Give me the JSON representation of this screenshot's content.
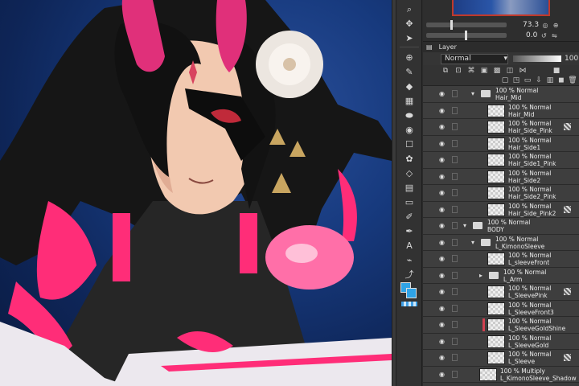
{
  "navigator": {
    "zoom_value": "73.3",
    "rotate_value": "0.0"
  },
  "layer_panel": {
    "tab_label": "Layer",
    "blend_mode": "Normal",
    "opacity": "100"
  },
  "layers": [
    {
      "line1": "100 % Normal",
      "line2": "Hair_Mid",
      "type": "folder",
      "indent": 1,
      "expanded": true
    },
    {
      "line1": "100 % Normal",
      "line2": "Hair_Mid",
      "type": "layer",
      "indent": 2
    },
    {
      "line1": "100 % Normal",
      "line2": "Hair_Side_Pink",
      "type": "layer",
      "indent": 2,
      "mask": true
    },
    {
      "line1": "100 % Normal",
      "line2": "Hair_Side1",
      "type": "layer",
      "indent": 2
    },
    {
      "line1": "100 % Normal",
      "line2": "Hair_Side1_Pink",
      "type": "layer",
      "indent": 2
    },
    {
      "line1": "100 % Normal",
      "line2": "Hair_Side2",
      "type": "layer",
      "indent": 2
    },
    {
      "line1": "100 % Normal",
      "line2": "Hair_Side2_Pink",
      "type": "layer",
      "indent": 2
    },
    {
      "line1": "100 % Normal",
      "line2": "Hair_Side_Pink2",
      "type": "layer",
      "indent": 2,
      "mask": true
    },
    {
      "line1": "100 % Normal",
      "line2": "BODY",
      "type": "folder",
      "indent": 0,
      "expanded": true
    },
    {
      "line1": "100 % Normal",
      "line2": "L_KimonoSleeve",
      "type": "folder",
      "indent": 1,
      "expanded": true
    },
    {
      "line1": "100 % Normal",
      "line2": "L_sleeveFront",
      "type": "layer",
      "indent": 2
    },
    {
      "line1": "100 % Normal",
      "line2": "L_Arm",
      "type": "folder",
      "indent": 2,
      "expanded": false
    },
    {
      "line1": "100 % Normal",
      "line2": "L_SleevePink",
      "type": "layer",
      "indent": 2,
      "mask": true
    },
    {
      "line1": "100 % Normal",
      "line2": "L_SleeveFront3",
      "type": "layer",
      "indent": 2
    },
    {
      "line1": "100 % Normal",
      "line2": "L_SleeveGoldShine",
      "type": "layer",
      "indent": 2,
      "clip": true
    },
    {
      "line1": "100 % Normal",
      "line2": "L_SleeveGold",
      "type": "layer",
      "indent": 2
    },
    {
      "line1": "100 % Normal",
      "line2": "L_Sleeve",
      "type": "layer",
      "indent": 2,
      "mask": true
    },
    {
      "line1": "100 % Multiply",
      "line2": "L_KimonoSleeve_Shadow",
      "type": "layer",
      "indent": 1
    }
  ],
  "tools": [
    "zoom-icon",
    "move-icon",
    "operation-icon",
    "move-layer-icon",
    "select-icon",
    "lasso-icon",
    "eyedropper-icon",
    "pen-icon",
    "pencil-icon",
    "brush-icon",
    "airbrush-icon",
    "decoration-icon",
    "eraser-icon",
    "blend-icon",
    "fill-icon",
    "gradient-icon",
    "figure-icon",
    "frame-icon",
    "ruler-icon",
    "text-icon",
    "balloon-icon",
    "correct-line-icon"
  ],
  "colors": {
    "main_color": "#2fa3e6",
    "sub_color": "#2fa3e6",
    "accent_pink": "#ff2d78",
    "background_blue": "#173a7e"
  }
}
